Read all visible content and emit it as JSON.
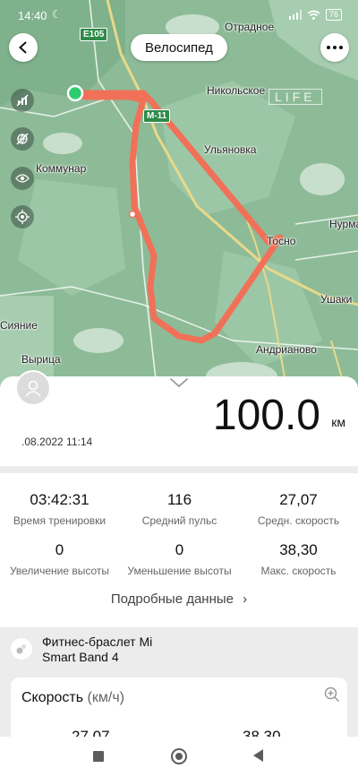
{
  "status_bar": {
    "time": "14:40",
    "battery": "76"
  },
  "header": {
    "activity_type": "Велосипед"
  },
  "map": {
    "labels": {
      "otradnoe": "Отрадное",
      "nikolskoe": "Никольское",
      "ulyanovka": "Ульяновка",
      "kommunar": "Коммунар",
      "tosno": "Тосно",
      "nurma": "Нурма",
      "ushaki": "Ушаки",
      "andrianovo": "Андрианово",
      "siyanie": "Сияние",
      "vyritsa": "Вырица"
    },
    "road_badges": {
      "e105": "E105",
      "m11": "M-11"
    },
    "watermark": "LIFE",
    "route_color": "#f07158"
  },
  "summary": {
    "distance": "100.0",
    "distance_unit": "км",
    "date": ".08.2022 11:14"
  },
  "stats": [
    {
      "value": "03:42:31",
      "label": "Время тренировки"
    },
    {
      "value": "116",
      "label": "Средний пульс"
    },
    {
      "value": "27,07",
      "label": "Средн. скорость"
    },
    {
      "value": "0",
      "label": "Увеличение высоты"
    },
    {
      "value": "0",
      "label": "Уменьшение высоты"
    },
    {
      "value": "38,30",
      "label": "Макс. скорость"
    }
  ],
  "details_link": "Подробные данные",
  "device": {
    "line1": "Фитнес-браслет Mi",
    "line2": "Smart Band 4"
  },
  "speed_section": {
    "title": "Скорость",
    "unit": "(км/ч)",
    "left_value": "27,07",
    "right_value": "38,30"
  }
}
